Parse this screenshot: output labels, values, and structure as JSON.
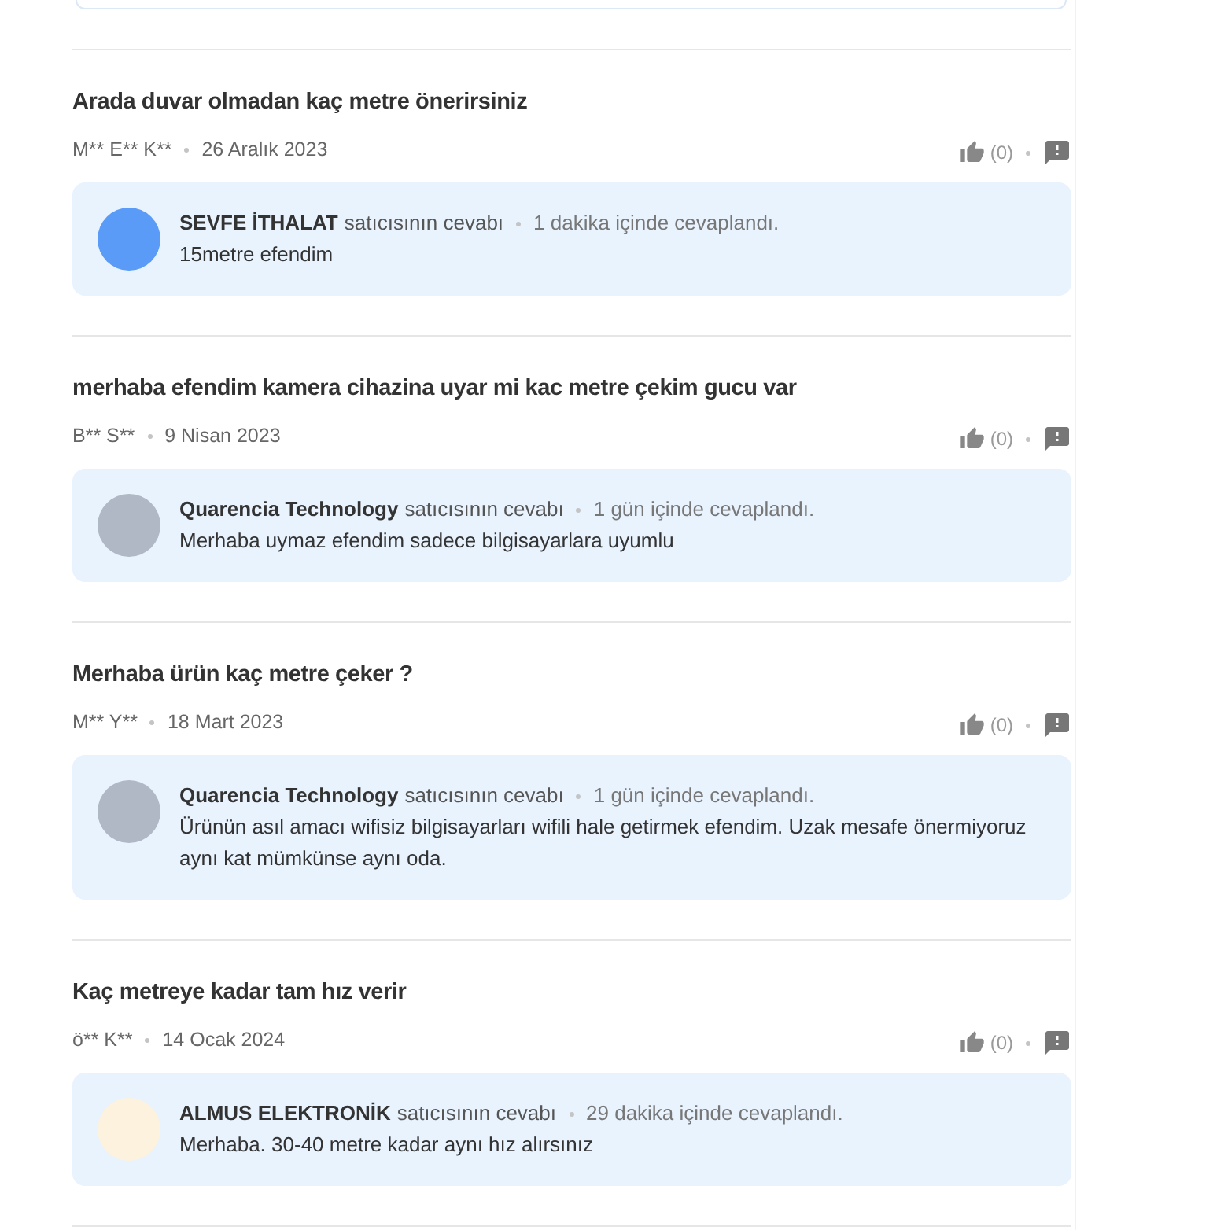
{
  "questions": [
    {
      "title": "Arada duvar olmadan kaç metre önerirsiniz",
      "author": "M** E** K**",
      "date": "26 Aralık 2023",
      "like_count": "(0)",
      "answer": {
        "avatar": {
          "color": "#5a9bf8"
        },
        "seller": "SEVFE İTHALAT",
        "label": "satıcısının cevabı",
        "response_time": "1 dakika içinde cevaplandı.",
        "text": "15metre efendim"
      }
    },
    {
      "title": "merhaba efendim kamera cihazina uyar mi kac metre çekim gucu var",
      "author": "B** S**",
      "date": "9 Nisan 2023",
      "like_count": "(0)",
      "answer": {
        "avatar": {
          "color": "#b0b8c5"
        },
        "seller": "Quarencia Technology",
        "label": "satıcısının cevabı",
        "response_time": "1 gün içinde cevaplandı.",
        "text": "Merhaba uymaz efendim sadece bilgisayarlara uyumlu"
      }
    },
    {
      "title": "Merhaba ürün kaç metre çeker ?",
      "author": "M** Y**",
      "date": "18 Mart 2023",
      "like_count": "(0)",
      "answer": {
        "avatar": {
          "color": "#b0b8c5"
        },
        "seller": "Quarencia Technology",
        "label": "satıcısının cevabı",
        "response_time": "1 gün içinde cevaplandı.",
        "text": "Ürünün asıl amacı wifisiz bilgisayarları wifili hale getirmek efendim. Uzak mesafe önermiyoruz aynı kat mümkünse aynı oda."
      }
    },
    {
      "title": "Kaç metreye kadar tam hız verir",
      "author": "ö** K**",
      "date": "14 Ocak 2024",
      "like_count": "(0)",
      "answer": {
        "avatar": {
          "color": "#fcf2dd"
        },
        "seller": "ALMUS ELEKTRONİK",
        "label": "satıcısının cevabı",
        "response_time": "29 dakika içinde cevaplandı.",
        "text": "Merhaba. 30-40 metre kadar aynı hız alırsınız"
      }
    }
  ]
}
